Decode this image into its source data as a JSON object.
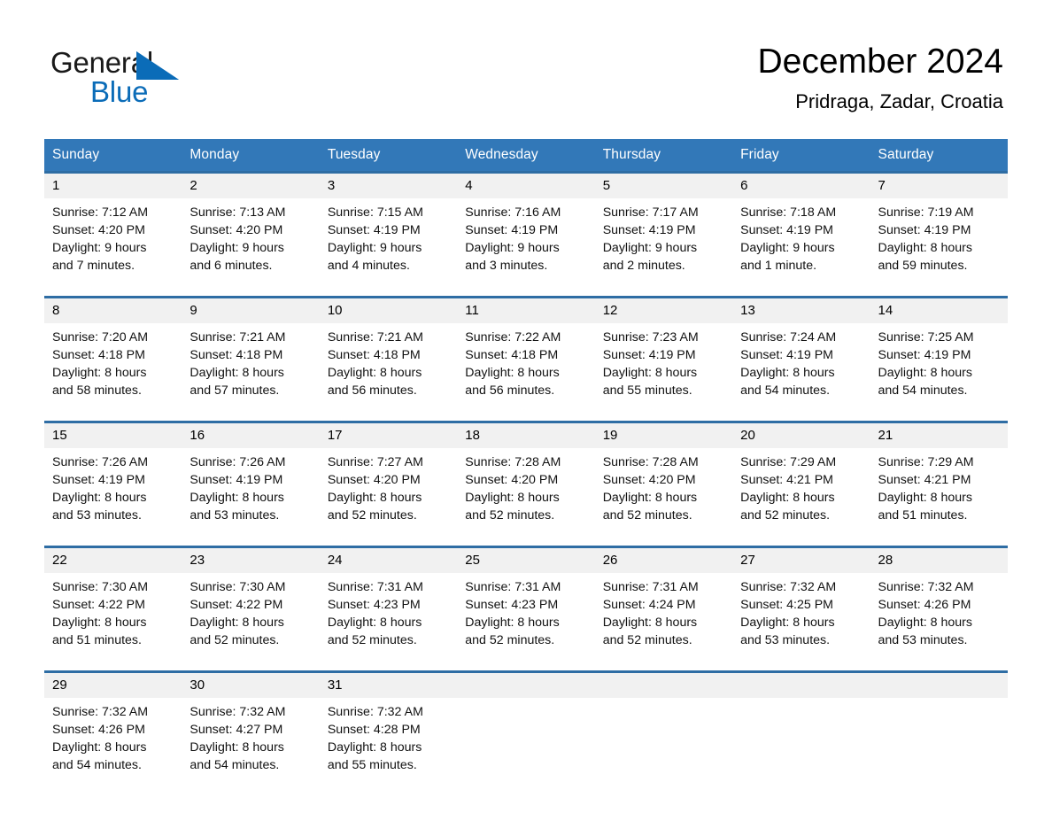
{
  "branding": {
    "logo_word1": "General",
    "logo_word2": "Blue",
    "logo_triangle": "triangle-icon",
    "accent_blue": "#0b6cb8"
  },
  "header": {
    "title": "December 2024",
    "location": "Pridraga, Zadar, Croatia"
  },
  "theme": {
    "header_bar_blue": "#3278b8",
    "row_rule_blue": "#2e6da4",
    "daynum_bg": "#f1f1f1",
    "cell_bg": "#ffffff"
  },
  "calendar": {
    "weekday_headers": [
      "Sunday",
      "Monday",
      "Tuesday",
      "Wednesday",
      "Thursday",
      "Friday",
      "Saturday"
    ],
    "weeks": [
      {
        "days": [
          {
            "date": "1",
            "sunrise": "Sunrise: 7:12 AM",
            "sunset": "Sunset: 4:20 PM",
            "daylight_line1": "Daylight: 9 hours",
            "daylight_line2": "and 7 minutes."
          },
          {
            "date": "2",
            "sunrise": "Sunrise: 7:13 AM",
            "sunset": "Sunset: 4:20 PM",
            "daylight_line1": "Daylight: 9 hours",
            "daylight_line2": "and 6 minutes."
          },
          {
            "date": "3",
            "sunrise": "Sunrise: 7:15 AM",
            "sunset": "Sunset: 4:19 PM",
            "daylight_line1": "Daylight: 9 hours",
            "daylight_line2": "and 4 minutes."
          },
          {
            "date": "4",
            "sunrise": "Sunrise: 7:16 AM",
            "sunset": "Sunset: 4:19 PM",
            "daylight_line1": "Daylight: 9 hours",
            "daylight_line2": "and 3 minutes."
          },
          {
            "date": "5",
            "sunrise": "Sunrise: 7:17 AM",
            "sunset": "Sunset: 4:19 PM",
            "daylight_line1": "Daylight: 9 hours",
            "daylight_line2": "and 2 minutes."
          },
          {
            "date": "6",
            "sunrise": "Sunrise: 7:18 AM",
            "sunset": "Sunset: 4:19 PM",
            "daylight_line1": "Daylight: 9 hours",
            "daylight_line2": "and 1 minute."
          },
          {
            "date": "7",
            "sunrise": "Sunrise: 7:19 AM",
            "sunset": "Sunset: 4:19 PM",
            "daylight_line1": "Daylight: 8 hours",
            "daylight_line2": "and 59 minutes."
          }
        ]
      },
      {
        "days": [
          {
            "date": "8",
            "sunrise": "Sunrise: 7:20 AM",
            "sunset": "Sunset: 4:18 PM",
            "daylight_line1": "Daylight: 8 hours",
            "daylight_line2": "and 58 minutes."
          },
          {
            "date": "9",
            "sunrise": "Sunrise: 7:21 AM",
            "sunset": "Sunset: 4:18 PM",
            "daylight_line1": "Daylight: 8 hours",
            "daylight_line2": "and 57 minutes."
          },
          {
            "date": "10",
            "sunrise": "Sunrise: 7:21 AM",
            "sunset": "Sunset: 4:18 PM",
            "daylight_line1": "Daylight: 8 hours",
            "daylight_line2": "and 56 minutes."
          },
          {
            "date": "11",
            "sunrise": "Sunrise: 7:22 AM",
            "sunset": "Sunset: 4:18 PM",
            "daylight_line1": "Daylight: 8 hours",
            "daylight_line2": "and 56 minutes."
          },
          {
            "date": "12",
            "sunrise": "Sunrise: 7:23 AM",
            "sunset": "Sunset: 4:19 PM",
            "daylight_line1": "Daylight: 8 hours",
            "daylight_line2": "and 55 minutes."
          },
          {
            "date": "13",
            "sunrise": "Sunrise: 7:24 AM",
            "sunset": "Sunset: 4:19 PM",
            "daylight_line1": "Daylight: 8 hours",
            "daylight_line2": "and 54 minutes."
          },
          {
            "date": "14",
            "sunrise": "Sunrise: 7:25 AM",
            "sunset": "Sunset: 4:19 PM",
            "daylight_line1": "Daylight: 8 hours",
            "daylight_line2": "and 54 minutes."
          }
        ]
      },
      {
        "days": [
          {
            "date": "15",
            "sunrise": "Sunrise: 7:26 AM",
            "sunset": "Sunset: 4:19 PM",
            "daylight_line1": "Daylight: 8 hours",
            "daylight_line2": "and 53 minutes."
          },
          {
            "date": "16",
            "sunrise": "Sunrise: 7:26 AM",
            "sunset": "Sunset: 4:19 PM",
            "daylight_line1": "Daylight: 8 hours",
            "daylight_line2": "and 53 minutes."
          },
          {
            "date": "17",
            "sunrise": "Sunrise: 7:27 AM",
            "sunset": "Sunset: 4:20 PM",
            "daylight_line1": "Daylight: 8 hours",
            "daylight_line2": "and 52 minutes."
          },
          {
            "date": "18",
            "sunrise": "Sunrise: 7:28 AM",
            "sunset": "Sunset: 4:20 PM",
            "daylight_line1": "Daylight: 8 hours",
            "daylight_line2": "and 52 minutes."
          },
          {
            "date": "19",
            "sunrise": "Sunrise: 7:28 AM",
            "sunset": "Sunset: 4:20 PM",
            "daylight_line1": "Daylight: 8 hours",
            "daylight_line2": "and 52 minutes."
          },
          {
            "date": "20",
            "sunrise": "Sunrise: 7:29 AM",
            "sunset": "Sunset: 4:21 PM",
            "daylight_line1": "Daylight: 8 hours",
            "daylight_line2": "and 52 minutes."
          },
          {
            "date": "21",
            "sunrise": "Sunrise: 7:29 AM",
            "sunset": "Sunset: 4:21 PM",
            "daylight_line1": "Daylight: 8 hours",
            "daylight_line2": "and 51 minutes."
          }
        ]
      },
      {
        "days": [
          {
            "date": "22",
            "sunrise": "Sunrise: 7:30 AM",
            "sunset": "Sunset: 4:22 PM",
            "daylight_line1": "Daylight: 8 hours",
            "daylight_line2": "and 51 minutes."
          },
          {
            "date": "23",
            "sunrise": "Sunrise: 7:30 AM",
            "sunset": "Sunset: 4:22 PM",
            "daylight_line1": "Daylight: 8 hours",
            "daylight_line2": "and 52 minutes."
          },
          {
            "date": "24",
            "sunrise": "Sunrise: 7:31 AM",
            "sunset": "Sunset: 4:23 PM",
            "daylight_line1": "Daylight: 8 hours",
            "daylight_line2": "and 52 minutes."
          },
          {
            "date": "25",
            "sunrise": "Sunrise: 7:31 AM",
            "sunset": "Sunset: 4:23 PM",
            "daylight_line1": "Daylight: 8 hours",
            "daylight_line2": "and 52 minutes."
          },
          {
            "date": "26",
            "sunrise": "Sunrise: 7:31 AM",
            "sunset": "Sunset: 4:24 PM",
            "daylight_line1": "Daylight: 8 hours",
            "daylight_line2": "and 52 minutes."
          },
          {
            "date": "27",
            "sunrise": "Sunrise: 7:32 AM",
            "sunset": "Sunset: 4:25 PM",
            "daylight_line1": "Daylight: 8 hours",
            "daylight_line2": "and 53 minutes."
          },
          {
            "date": "28",
            "sunrise": "Sunrise: 7:32 AM",
            "sunset": "Sunset: 4:26 PM",
            "daylight_line1": "Daylight: 8 hours",
            "daylight_line2": "and 53 minutes."
          }
        ]
      },
      {
        "days": [
          {
            "date": "29",
            "sunrise": "Sunrise: 7:32 AM",
            "sunset": "Sunset: 4:26 PM",
            "daylight_line1": "Daylight: 8 hours",
            "daylight_line2": "and 54 minutes."
          },
          {
            "date": "30",
            "sunrise": "Sunrise: 7:32 AM",
            "sunset": "Sunset: 4:27 PM",
            "daylight_line1": "Daylight: 8 hours",
            "daylight_line2": "and 54 minutes."
          },
          {
            "date": "31",
            "sunrise": "Sunrise: 7:32 AM",
            "sunset": "Sunset: 4:28 PM",
            "daylight_line1": "Daylight: 8 hours",
            "daylight_line2": "and 55 minutes."
          },
          {
            "date": "",
            "sunrise": "",
            "sunset": "",
            "daylight_line1": "",
            "daylight_line2": ""
          },
          {
            "date": "",
            "sunrise": "",
            "sunset": "",
            "daylight_line1": "",
            "daylight_line2": ""
          },
          {
            "date": "",
            "sunrise": "",
            "sunset": "",
            "daylight_line1": "",
            "daylight_line2": ""
          },
          {
            "date": "",
            "sunrise": "",
            "sunset": "",
            "daylight_line1": "",
            "daylight_line2": ""
          }
        ]
      }
    ]
  }
}
